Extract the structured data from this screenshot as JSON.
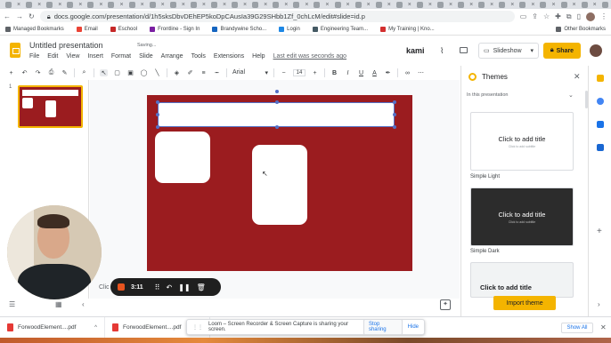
{
  "browser": {
    "url": "docs.google.com/presentation/d/1h5sksDbvDEhEP5koDpCAusIa39G29SHbb1Zf_0chLcM/edit#slide=id.p"
  },
  "bookmarks": {
    "items": [
      "Managed Bookmarks",
      "Email",
      "Eschool",
      "Frontline - Sign In",
      "Brandywine Scho...",
      "Login",
      "Engineering Team...",
      "My Training | Kno..."
    ],
    "other": "Other Bookmarks"
  },
  "slides": {
    "title": "Untitled presentation",
    "saving": "Saving...",
    "menu": [
      "File",
      "Edit",
      "View",
      "Insert",
      "Format",
      "Slide",
      "Arrange",
      "Tools",
      "Extensions",
      "Help"
    ],
    "last_edit": "Last edit was seconds ago",
    "kami": "kami",
    "slideshow": "Slideshow",
    "share": "Share"
  },
  "toolbar": {
    "font": "Arial",
    "font_size": "14"
  },
  "filmstrip": {
    "slide_number": "1"
  },
  "editor": {
    "notes_placeholder": "Clic"
  },
  "loom": {
    "time": "3:11",
    "notice": "Loom – Screen Recorder & Screen Capture is sharing your screen.",
    "stop_sharing": "Stop sharing",
    "hide": "Hide"
  },
  "themes": {
    "title": "Themes",
    "section": "In this presentation",
    "cards": [
      {
        "title": "Click to add title",
        "subtitle": "Click to add subtitle",
        "name": "Simple Light"
      },
      {
        "title": "Click to add title",
        "subtitle": "Click to add subtitle",
        "name": "Simple Dark"
      },
      {
        "title": "Click to add title"
      }
    ],
    "import": "Import theme"
  },
  "downloads": {
    "items": [
      "ForwoodElement....pdf",
      "ForwoodElement....pdf"
    ],
    "show_all": "Show All"
  },
  "colors": {
    "slide_background": "#9b1c1f",
    "accent": "#f4b400",
    "selection": "#5470c6"
  }
}
